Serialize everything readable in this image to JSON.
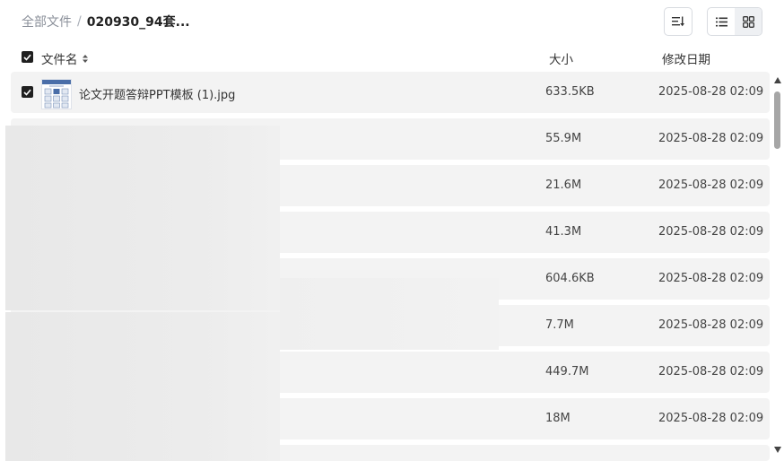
{
  "breadcrumb": {
    "root": "全部文件",
    "separator": "/",
    "current": "020930_94套..."
  },
  "toolbar": {
    "sort_icon": "sort-icon",
    "list_view_icon": "list-view-icon",
    "grid_view_icon": "grid-view-icon",
    "active_view": "list"
  },
  "header": {
    "name": "文件名",
    "size": "大小",
    "date": "修改日期"
  },
  "files": [
    {
      "name": "论文开题答辩PPT模板 (1).jpg",
      "size": "633.5KB",
      "date": "2025-08-28 02:09",
      "checked": true
    },
    {
      "name": "",
      "size": "55.9M",
      "date": "2025-08-28 02:09"
    },
    {
      "name": "",
      "size": "21.6M",
      "date": "2025-08-28 02:09"
    },
    {
      "name": "",
      "size": "41.3M",
      "date": "2025-08-28 02:09"
    },
    {
      "name": "",
      "size": "604.6KB",
      "date": "2025-08-28 02:09"
    },
    {
      "name": "",
      "size": "7.7M",
      "date": "2025-08-28 02:09"
    },
    {
      "name": "",
      "size": "449.7M",
      "date": "2025-08-28 02:09"
    },
    {
      "name": "",
      "size": "18M",
      "date": "2025-08-28 02:09"
    }
  ]
}
